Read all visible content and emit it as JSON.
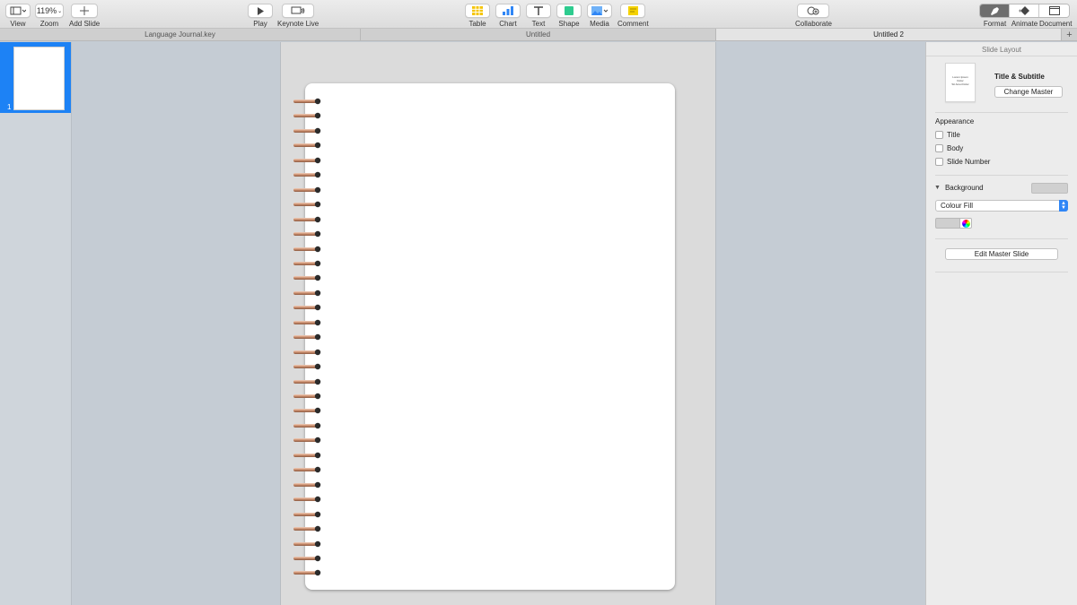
{
  "toolbar": {
    "view_label": "View",
    "zoom_value": "119%",
    "zoom_label": "Zoom",
    "add_slide_label": "Add Slide",
    "play_label": "Play",
    "keynote_live_label": "Keynote Live",
    "table_label": "Table",
    "chart_label": "Chart",
    "text_label": "Text",
    "shape_label": "Shape",
    "media_label": "Media",
    "comment_label": "Comment",
    "collaborate_label": "Collaborate",
    "format_label": "Format",
    "animate_label": "Animate",
    "document_label": "Document"
  },
  "tabs": [
    {
      "label": "Language Journal.key",
      "active": false
    },
    {
      "label": "Untitled",
      "active": false
    },
    {
      "label": "Untitled 2",
      "active": true
    }
  ],
  "navigator": {
    "slides": [
      {
        "number": "1",
        "selected": true
      }
    ]
  },
  "inspector": {
    "header": "Slide Layout",
    "master_name": "Title & Subtitle",
    "master_thumb_lines": [
      "Lorem Ipsum",
      "Dolor",
      "Sit Amet Dolor"
    ],
    "change_master_label": "Change Master",
    "appearance_label": "Appearance",
    "appearance_options": [
      {
        "label": "Title",
        "checked": false
      },
      {
        "label": "Body",
        "checked": false
      },
      {
        "label": "Slide Number",
        "checked": false
      }
    ],
    "background_label": "Background",
    "fill_type": "Colour Fill",
    "edit_master_label": "Edit Master Slide"
  },
  "colors": {
    "selection_blue": "#1d82f5",
    "ring_copper": "#c98b6a",
    "active_segment": "#6e6e6e"
  }
}
